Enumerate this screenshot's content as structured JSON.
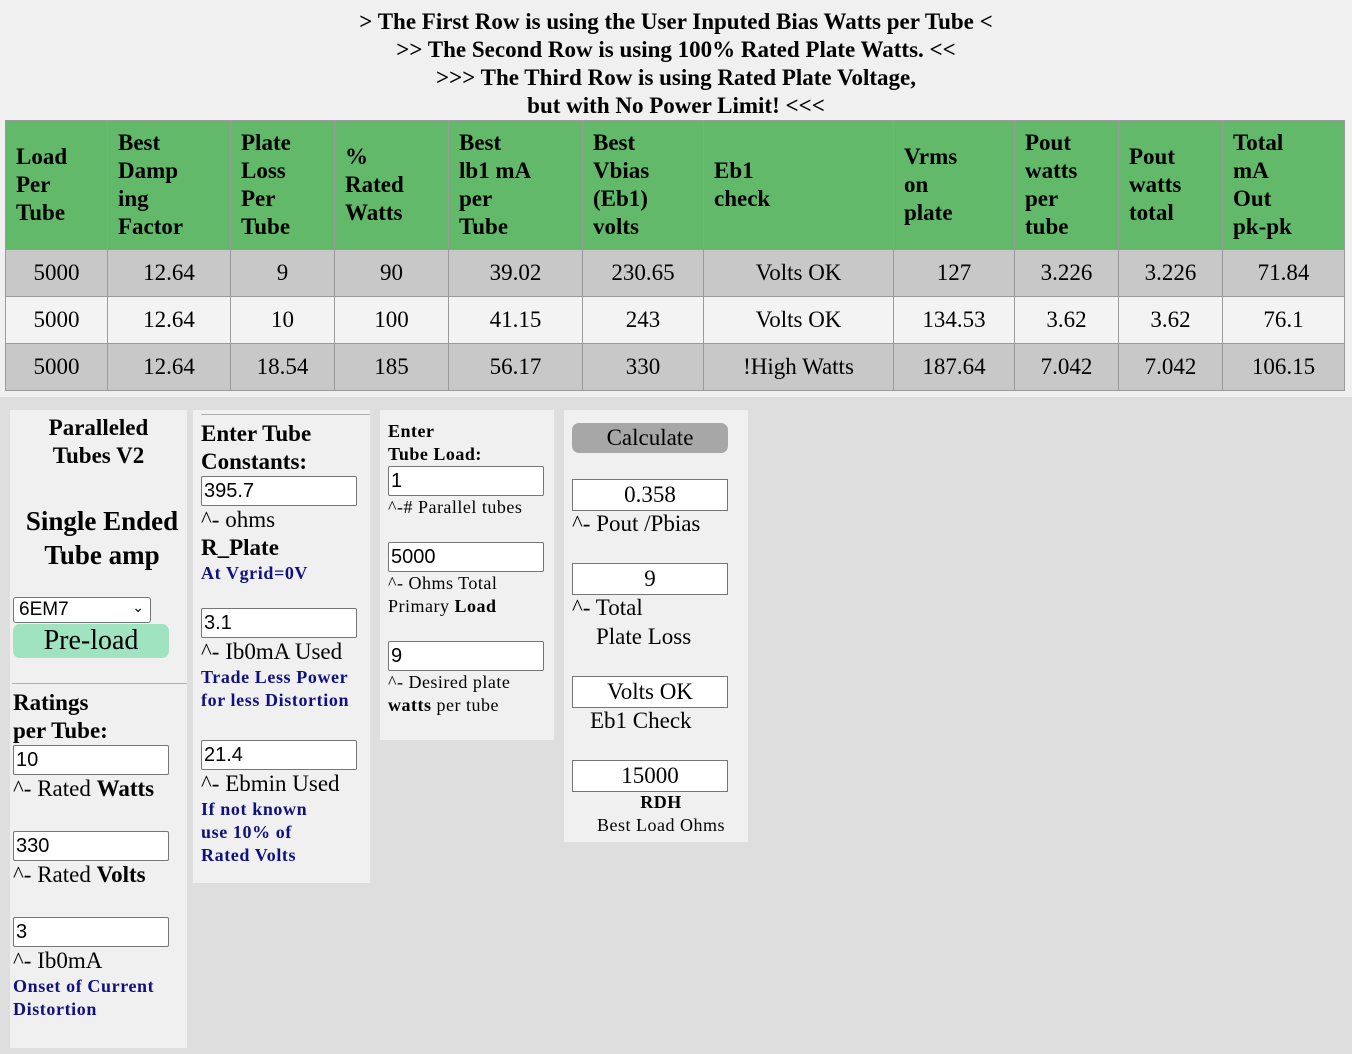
{
  "header": {
    "line1": "> The First Row is using the User Inputed Bias Watts per Tube <",
    "line2": ">> The Second Row is using 100% Rated Plate Watts. <<",
    "line3": ">>> The Third Row is using Rated Plate Voltage,",
    "line4": "but with No Power Limit! <<<"
  },
  "table": {
    "columns": [
      [
        "Load",
        "Per",
        "Tube"
      ],
      [
        "Best",
        "Damp",
        "ing",
        "Factor"
      ],
      [
        "Plate",
        "Loss",
        "Per",
        "Tube"
      ],
      [
        "%",
        "Rated",
        "Watts"
      ],
      [
        "Best",
        "lb1 mA",
        "per",
        "Tube"
      ],
      [
        "Best",
        "Vbias",
        "(Eb1)",
        "volts"
      ],
      [
        "Eb1",
        "check"
      ],
      [
        "Vrms",
        "on",
        "plate"
      ],
      [
        "Pout",
        "watts",
        "per",
        "tube"
      ],
      [
        "Pout",
        "watts",
        "total"
      ],
      [
        "Total",
        "mA",
        "Out",
        "pk-pk"
      ]
    ],
    "rows": [
      [
        "5000",
        "12.64",
        "9",
        "90",
        "39.02",
        "230.65",
        "Volts OK",
        "127",
        "3.226",
        "3.226",
        "71.84"
      ],
      [
        "5000",
        "12.64",
        "10",
        "100",
        "41.15",
        "243",
        "Volts OK",
        "134.53",
        "3.62",
        "3.62",
        "76.1"
      ],
      [
        "5000",
        "12.64",
        "18.54",
        "185",
        "56.17",
        "330",
        "!High Watts",
        "187.64",
        "7.042",
        "7.042",
        "106.15"
      ]
    ]
  },
  "panel1": {
    "title1": "Paralleled",
    "title2": "Tubes V2",
    "subtitle1": "Single Ended",
    "subtitle2": "Tube amp",
    "tube_select": "6EM7",
    "preload_label": "Pre-load",
    "ratings1": "Ratings",
    "ratings2": "per Tube:",
    "rated_watts_value": "10",
    "rated_watts_prefix": "^- Rated ",
    "rated_watts_bold": "Watts",
    "rated_volts_value": "330",
    "rated_volts_prefix": "^- Rated ",
    "rated_volts_bold": "Volts",
    "ib0_value": "3",
    "ib0_label": "^- Ib0mA",
    "ib0_note1": "Onset of Current",
    "ib0_note2": "Distortion"
  },
  "panel2": {
    "title1": "Enter Tube",
    "title2": "Constants:",
    "rplate_value": "395.7",
    "rplate_label": "^- ohms",
    "rplate_name": "R_Plate",
    "rplate_note": "At Vgrid=0V",
    "ib0_used_value": "3.1",
    "ib0_used_label": "^- Ib0mA Used",
    "ib0_note1": "Trade Less Power",
    "ib0_note2": "for less Distortion",
    "ebmin_value": "21.4",
    "ebmin_label": "^- Ebmin Used",
    "ebmin_note1": "If not known",
    "ebmin_note2": "use 10% of",
    "ebmin_note3": "Rated Volts"
  },
  "panel3": {
    "title1": "Enter",
    "title2": "Tube Load:",
    "parallel_value": "1",
    "parallel_label": "^-# Parallel tubes",
    "load_value": "5000",
    "load_label1": "^- Ohms Total",
    "load_label2_prefix": "Primary ",
    "load_label2_bold": "Load",
    "watts_value": "9",
    "watts_label1": "^- Desired plate",
    "watts_label2_bold": "watts",
    "watts_label2_suffix": " per tube"
  },
  "panel4": {
    "calculate_label": "Calculate",
    "pout_ratio": "0.358",
    "pout_ratio_label": "^- Pout /Pbias",
    "plate_loss": "9",
    "plate_loss_label1": "^- Total",
    "plate_loss_label2": "Plate Loss",
    "eb1_check": "Volts OK",
    "eb1_check_label": "Eb1 Check",
    "rdh": "15000",
    "rdh_label": "RDH",
    "rdh_sub": "Best Load Ohms"
  }
}
